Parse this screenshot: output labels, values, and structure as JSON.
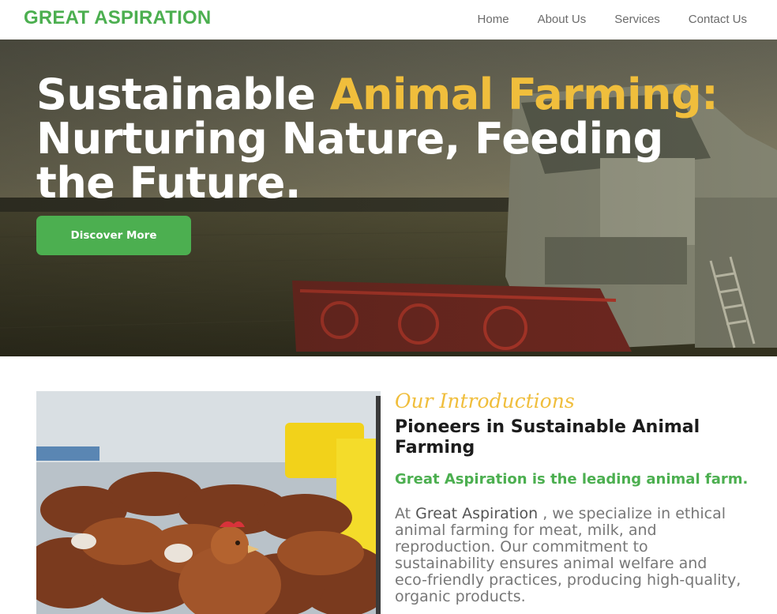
{
  "brand": "GREAT ASPIRATION",
  "nav": [
    {
      "label": "Home"
    },
    {
      "label": "About Us"
    },
    {
      "label": "Services"
    },
    {
      "label": "Contact Us"
    }
  ],
  "hero": {
    "title_part1": "Sustainable ",
    "title_highlight": "Animal Farming:",
    "title_part2": " Nurturing Nature, Feeding the Future.",
    "cta_label": "Discover More"
  },
  "intro": {
    "kicker": "Our Introductions",
    "heading": "Pioneers in Sustainable Animal Farming",
    "lead": "Great Aspiration is the leading animal farm.",
    "body_prefix": "At ",
    "body_name": "Great Aspiration",
    "body_rest": " , we specialize in ethical animal farming for meat, milk, and reproduction. Our commitment to sustainability ensures animal welfare and eco-friendly practices, producing high-quality, organic products."
  },
  "colors": {
    "brand_green": "#4caf50",
    "accent_yellow": "#f0be3c",
    "text_dark": "#1c1c1c",
    "text_muted": "#777777"
  }
}
